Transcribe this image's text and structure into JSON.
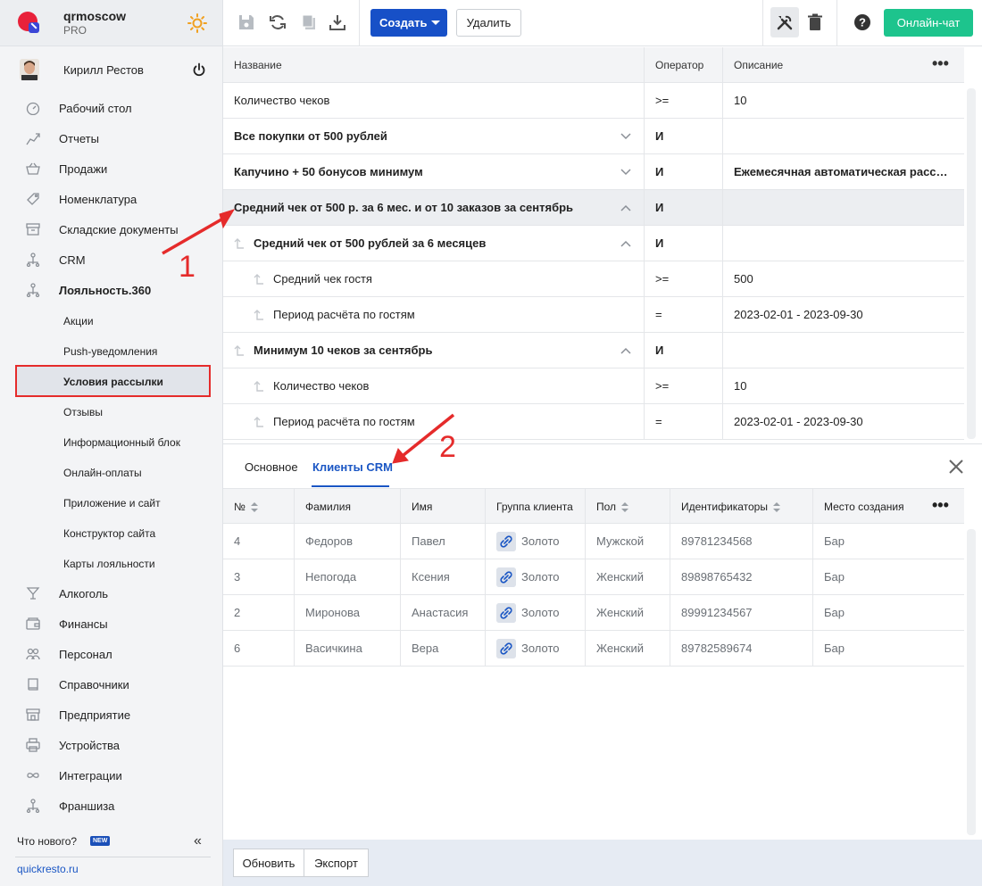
{
  "brand": {
    "name": "qrmoscow",
    "plan": "PRO"
  },
  "user": {
    "name": "Кирилл Рестов"
  },
  "nav": [
    {
      "label": "Рабочий стол",
      "icon": "gauge-icon"
    },
    {
      "label": "Отчеты",
      "icon": "chart-icon"
    },
    {
      "label": "Продажи",
      "icon": "basket-icon"
    },
    {
      "label": "Номенклатура",
      "icon": "tag-icon"
    },
    {
      "label": "Складские документы",
      "icon": "archive-icon"
    },
    {
      "label": "CRM",
      "icon": "hierarchy-icon"
    },
    {
      "label": "Лояльность.360",
      "icon": "hierarchy-icon"
    }
  ],
  "loyalty_sub": [
    "Акции",
    "Push-уведомления",
    "Условия рассылки",
    "Отзывы",
    "Информационный блок",
    "Онлайн-оплаты",
    "Приложение и сайт",
    "Конструктор сайта",
    "Карты лояльности"
  ],
  "nav2": [
    {
      "label": "Алкоголь",
      "icon": "glass-icon"
    },
    {
      "label": "Финансы",
      "icon": "wallet-icon"
    },
    {
      "label": "Персонал",
      "icon": "people-icon"
    },
    {
      "label": "Справочники",
      "icon": "book-icon"
    },
    {
      "label": "Предприятие",
      "icon": "store-icon"
    },
    {
      "label": "Устройства",
      "icon": "printer-icon"
    },
    {
      "label": "Интеграции",
      "icon": "infinity-icon"
    },
    {
      "label": "Франшиза",
      "icon": "hierarchy-icon"
    }
  ],
  "sidebar_footer": {
    "whats_new": "Что нового?",
    "badge": "NEW",
    "site": "quickresto.ru"
  },
  "toolbar": {
    "create": "Создать",
    "delete": "Удалить",
    "chat": "Онлайн-чат"
  },
  "conditions": {
    "headers": {
      "name": "Название",
      "operator": "Оператор",
      "description": "Описание"
    },
    "rows": [
      {
        "name": "Количество чеков",
        "operator": ">=",
        "description": "10",
        "level": 0,
        "bold": false,
        "chevron": ""
      },
      {
        "name": "Все покупки от 500 рублей",
        "operator": "И",
        "description": "",
        "level": 0,
        "bold": true,
        "chevron": "down"
      },
      {
        "name": "Капучино + 50 бонусов минимум",
        "operator": "И",
        "description": "Ежемесячная автоматическая рассылка",
        "level": 0,
        "bold": true,
        "chevron": "down"
      },
      {
        "name": "Средний чек от 500 р. за 6 мес. и от 10 заказов за сентябрь",
        "operator": "И",
        "description": "",
        "level": 0,
        "bold": true,
        "chevron": "up",
        "selected": true
      },
      {
        "name": "Средний чек от 500 рублей за 6 месяцев",
        "operator": "И",
        "description": "",
        "level": 1,
        "bold": true,
        "chevron": "up"
      },
      {
        "name": "Средний чек гостя",
        "operator": ">=",
        "description": "500",
        "level": 2,
        "bold": false,
        "chevron": ""
      },
      {
        "name": "Период расчёта по гостям",
        "operator": "=",
        "description": "2023-02-01 - 2023-09-30",
        "level": 2,
        "bold": false,
        "chevron": ""
      },
      {
        "name": "Минимум 10 чеков за сентябрь",
        "operator": "И",
        "description": "",
        "level": 1,
        "bold": true,
        "chevron": "up"
      },
      {
        "name": "Количество чеков",
        "operator": ">=",
        "description": "10",
        "level": 2,
        "bold": false,
        "chevron": ""
      },
      {
        "name": "Период расчёта по гостям",
        "operator": "=",
        "description": "2023-02-01 - 2023-09-30",
        "level": 2,
        "bold": false,
        "chevron": ""
      }
    ]
  },
  "tabs": [
    {
      "label": "Основное"
    },
    {
      "label": "Клиенты CRM"
    }
  ],
  "clients": {
    "headers": {
      "num": "№",
      "last": "Фамилия",
      "first": "Имя",
      "group": "Группа клиента",
      "gender": "Пол",
      "ids": "Идентификаторы",
      "place": "Место создания"
    },
    "rows": [
      {
        "num": "4",
        "last": "Федоров",
        "first": "Павел",
        "group": "Золото",
        "gender": "Мужской",
        "ids": "89781234568",
        "place": "Бар"
      },
      {
        "num": "3",
        "last": "Непогода",
        "first": "Ксения",
        "group": "Золото",
        "gender": "Женский",
        "ids": "89898765432",
        "place": "Бар"
      },
      {
        "num": "2",
        "last": "Миронова",
        "first": "Анастасия",
        "group": "Золото",
        "gender": "Женский",
        "ids": "89991234567",
        "place": "Бар"
      },
      {
        "num": "6",
        "last": "Васичкина",
        "first": "Вера",
        "group": "Золото",
        "gender": "Женский",
        "ids": "89782589674",
        "place": "Бар"
      }
    ]
  },
  "footer": {
    "refresh": "Обновить",
    "export": "Экспорт"
  },
  "annotations": [
    "1",
    "2"
  ],
  "colors": {
    "accent": "#1750c7",
    "chat": "#1dc48d",
    "annotation": "#e52b2b"
  }
}
